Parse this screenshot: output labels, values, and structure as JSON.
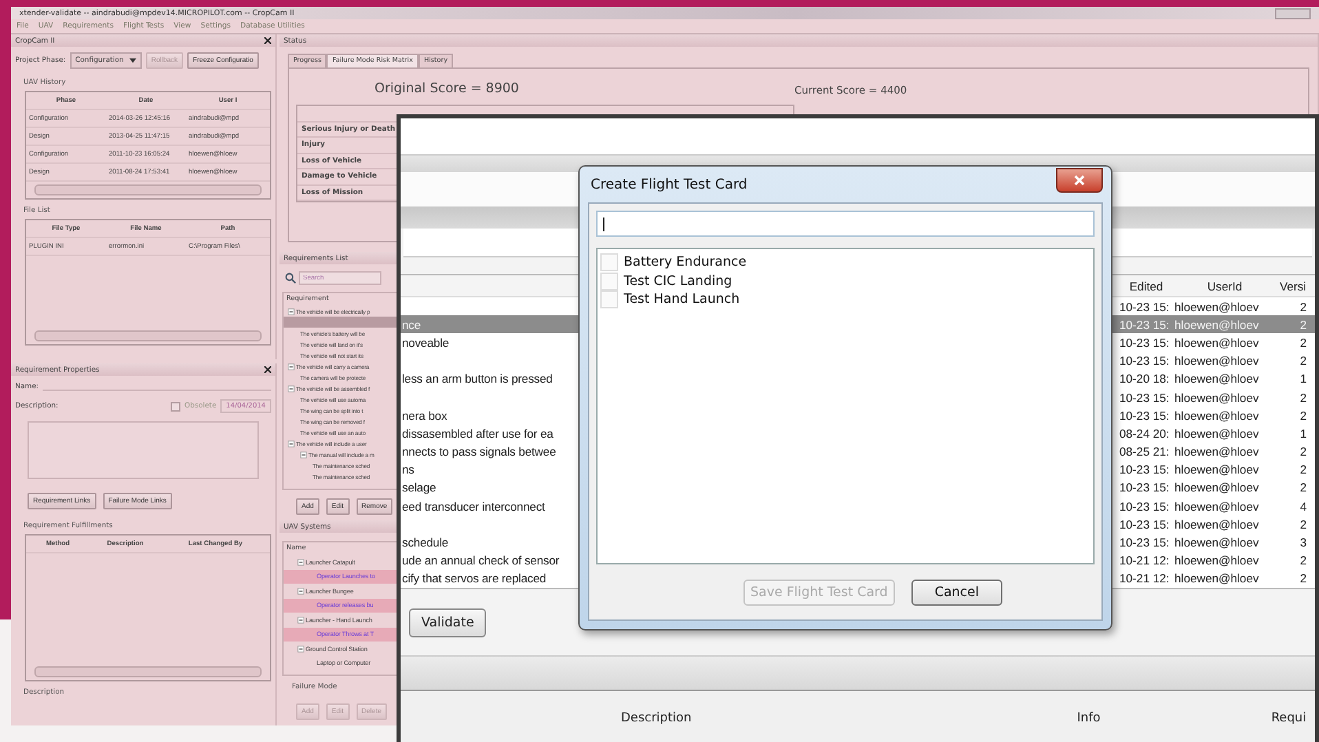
{
  "app": {
    "title": "xtender-validate -- aindrabudi@mpdev14.MICROPILOT.com -- CropCam II",
    "menu": [
      "File",
      "UAV",
      "Requirements",
      "Flight Tests",
      "View",
      "Settings",
      "Database Utilities"
    ],
    "project_panel": {
      "title": "CropCam II",
      "phase_label": "Project Phase:",
      "phase_value": "Configuration",
      "buttons": [
        {
          "label": "Rollback",
          "disabled": true
        },
        {
          "label": "Freeze Configuratio",
          "disabled": false
        }
      ],
      "history": {
        "title": "UAV History",
        "columns": [
          "Phase",
          "Date",
          "User I"
        ],
        "rows": [
          [
            "Configuration",
            "2014-03-26 12:45:16",
            "aindrabudi@mpd"
          ],
          [
            "Design",
            "2013-04-25 11:47:15",
            "aindrabudi@mpd"
          ],
          [
            "Configuration",
            "2011-10-23 16:05:24",
            "hloewen@hloew"
          ],
          [
            "Design",
            "2011-08-24 17:53:41",
            "hloewen@hloew"
          ]
        ]
      },
      "files": {
        "title": "File List",
        "columns": [
          "File Type",
          "File Name",
          "Path"
        ],
        "rows": [
          [
            "PLUGIN INI",
            "errormon.ini",
            "C:\\Program Files\\"
          ]
        ]
      }
    },
    "properties": {
      "title": "Requirement Properties",
      "name_label": "Name:",
      "description_label": "Description:",
      "obsolete": {
        "label": "Obsolete",
        "checked": false
      },
      "date": "14/04/2014",
      "buttons": [
        "Requirement Links",
        "Failure Mode Links"
      ],
      "fulfillments": {
        "title": "Requirement Fulfillments",
        "columns": [
          "Method",
          "Description",
          "Last Changed By"
        ]
      },
      "description_title": "Description"
    },
    "status": {
      "title": "Status",
      "tabs": [
        {
          "label": "Progress",
          "selected": false
        },
        {
          "label": "Failure Mode Risk Matrix",
          "selected": true
        },
        {
          "label": "History",
          "selected": false
        }
      ],
      "original_score": "Original Score  = 8900",
      "current_score": "Current Score  = 4400",
      "risk_rows": [
        "Serious Injury or Death",
        "Injury",
        "Loss of Vehicle",
        "Damage to Vehicle",
        "Loss of Mission"
      ]
    },
    "requirements": {
      "title": "Requirements List",
      "search_placeholder": "Search",
      "column": "Requirement",
      "tree": [
        {
          "label": "The vehicle will be electrically p",
          "selected": false,
          "children": [
            {
              "selected": true
            },
            {
              "label": "The vehicle's battery will be",
              "selected": false
            },
            {
              "label": "The vehicle will land on it's",
              "selected": false
            },
            {
              "label": "The vehicle will not start its",
              "selected": false
            }
          ]
        },
        {
          "label": "The vehicle will carry a camera",
          "selected": false,
          "children": [
            {
              "label": "The camera will be protecte",
              "selected": false
            }
          ]
        },
        {
          "label": "The vehicle will be assembled f",
          "selected": false,
          "children": [
            {
              "label": "The vehicle will use automa",
              "selected": false
            },
            {
              "label": "The wing can be split into t",
              "selected": false
            },
            {
              "label": "The wing can be removed f",
              "selected": false
            },
            {
              "label": "The vehicle will use an auto",
              "selected": false
            }
          ]
        },
        {
          "label": "The vehicle will include a user",
          "selected": false,
          "children": [
            {
              "label": "The manual will include a m",
              "selected": false,
              "children": [
                {
                  "label": "The maintenance sched",
                  "selected": false
                },
                {
                  "label": "The maintenance sched",
                  "selected": false
                }
              ]
            }
          ]
        }
      ],
      "buttons": [
        "Add",
        "Edit",
        "Remove"
      ]
    },
    "systems": {
      "title": "UAV Systems",
      "column": "Name",
      "tree": [
        {
          "label": "Launcher Catapult",
          "highlighted": false,
          "children": [
            {
              "label": "Operator Launches to",
              "highlighted": true
            }
          ]
        },
        {
          "label": "Launcher Bungee",
          "highlighted": false,
          "children": [
            {
              "label": "Operator releases bu",
              "highlighted": true
            }
          ]
        },
        {
          "label": "Launcher - Hand Launch",
          "highlighted": false,
          "children": [
            {
              "label": "Operator Throws at T",
              "highlighted": true
            }
          ]
        },
        {
          "label": "Ground Control Station",
          "highlighted": false,
          "children": [
            {
              "label": "Laptop or Computer",
              "highlighted": false
            }
          ]
        }
      ],
      "failure_title": "Failure Mode",
      "buttons": [
        {
          "label": "Add",
          "disabled": true
        },
        {
          "label": "Edit",
          "disabled": true
        },
        {
          "label": "Delete",
          "disabled": true
        }
      ]
    }
  },
  "validation_window": {
    "columns": [
      "Edited",
      "UserId",
      "Versi"
    ],
    "rows": [
      {
        "edited": "10-23 15:",
        "user": "hloewen@hloev",
        "version": "2",
        "selected": false
      },
      {
        "requirement": "nce",
        "edited": "10-23 15:",
        "user": "hloewen@hloev",
        "version": "2",
        "selected": true
      },
      {
        "requirement": "noveable",
        "edited": "10-23 15:",
        "user": "hloewen@hloev",
        "version": "2",
        "selected": false
      },
      {
        "edited": "10-23 15:",
        "user": "hloewen@hloev",
        "version": "2",
        "selected": false
      },
      {
        "requirement": "less an arm button is pressed",
        "edited": "10-20 18:",
        "user": "hloewen@hloev",
        "version": "1",
        "selected": false
      },
      {
        "edited": "10-23 15:",
        "user": "hloewen@hloev",
        "version": "2",
        "selected": false
      },
      {
        "requirement": "nera box",
        "edited": "10-23 15:",
        "user": "hloewen@hloev",
        "version": "2",
        "selected": false
      },
      {
        "requirement": "dissasembled after use for ea",
        "edited": "08-24 20:",
        "user": "hloewen@hloev",
        "version": "1",
        "selected": false
      },
      {
        "requirement": "nnects to pass signals betwee",
        "edited": "08-25 21:",
        "user": "hloewen@hloev",
        "version": "2",
        "selected": false
      },
      {
        "requirement": "ns",
        "edited": "10-23 15:",
        "user": "hloewen@hloev",
        "version": "2",
        "selected": false
      },
      {
        "requirement": "selage",
        "edited": "10-23 15:",
        "user": "hloewen@hloev",
        "version": "2",
        "selected": false
      },
      {
        "requirement": "eed transducer interconnect",
        "edited": "10-23 15:",
        "user": "hloewen@hloev",
        "version": "4",
        "selected": false
      },
      {
        "edited": "10-23 15:",
        "user": "hloewen@hloev",
        "version": "2",
        "selected": false
      },
      {
        "requirement": "schedule",
        "edited": "10-23 15:",
        "user": "hloewen@hloev",
        "version": "3",
        "selected": false
      },
      {
        "requirement": "ude an annual check of sensor",
        "edited": "10-21 12:",
        "user": "hloewen@hloev",
        "version": "2",
        "selected": false
      },
      {
        "requirement": "cify that servos are replaced",
        "edited": "10-21 12:",
        "user": "hloewen@hloev",
        "version": "2",
        "selected": false
      }
    ],
    "validate_button": "Validate",
    "footer_columns": [
      "Description",
      "Info",
      "Requi"
    ]
  },
  "dialog": {
    "title": "Create Flight Test Card",
    "items": [
      {
        "label": "Battery Endurance",
        "checked": false
      },
      {
        "label": "Test CIC Landing",
        "checked": false
      },
      {
        "label": "Test Hand Launch",
        "checked": false
      }
    ],
    "save_button": {
      "label": "Save Flight Test Card",
      "disabled": true
    },
    "cancel_button": "Cancel"
  }
}
